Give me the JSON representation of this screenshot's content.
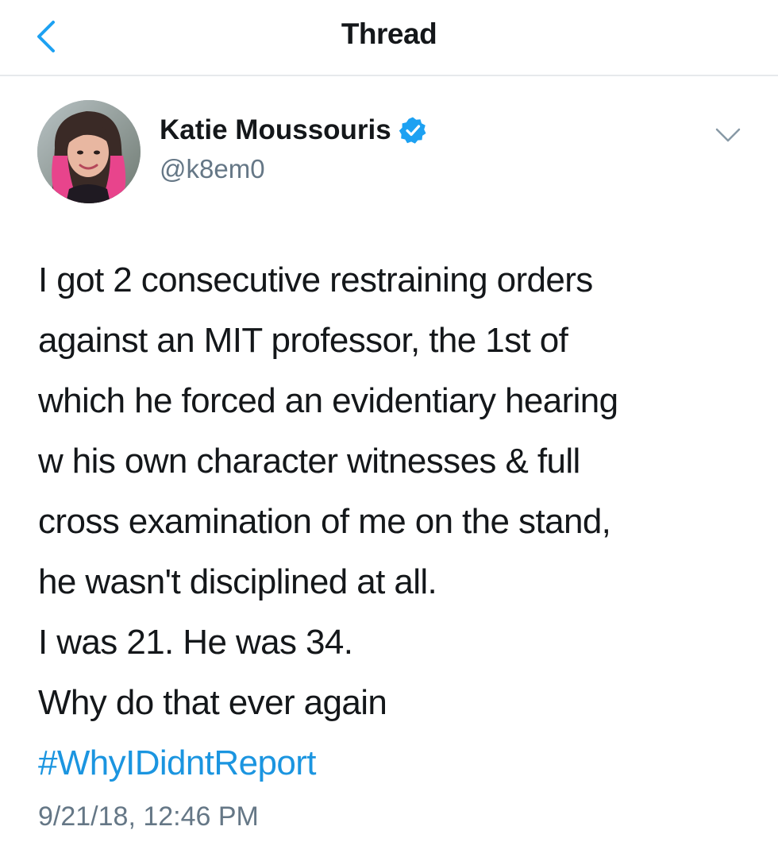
{
  "header": {
    "title": "Thread",
    "back_icon": "chevron-left-icon",
    "accent_color": "#1da1f2"
  },
  "tweet": {
    "author": {
      "name": "Katie Moussouris",
      "handle": "@k8em0",
      "verified": true,
      "verified_icon": "verified-badge-icon"
    },
    "menu_icon": "chevron-down-icon",
    "text_lines": [
      "I got 2 consecutive restraining orders",
      "against an MIT professor, the 1st of",
      "which he forced an evidentiary hearing",
      "w his own character witnesses & full",
      "cross examination of me on the stand,",
      "he wasn't disciplined at all.",
      "I was 21. He was 34.",
      "Why do that ever again"
    ],
    "hashtag": "#WhyIDidntReport",
    "hashtag_color": "#1b95e0",
    "timestamp": "9/21/18, 12:46 PM"
  }
}
